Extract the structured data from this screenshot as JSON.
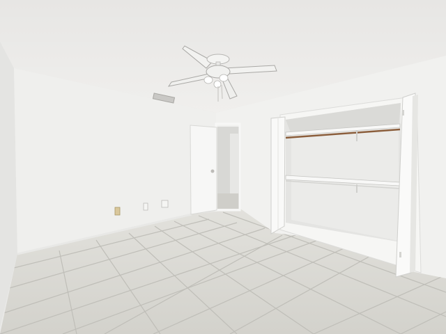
{
  "scene": {
    "colors": {
      "ceiling": "#ecebea",
      "wall_back": "#efefed",
      "wall_left": "#e4e4e2",
      "wall_right": "#f1f1ef",
      "floor": "#dcdbd6",
      "grout": "#bdbcb7",
      "door": "#f6f6f5",
      "closet_interior": "#e6e6e4",
      "fan_body": "#f3f3f1",
      "wood_rod": "#8b5e3c"
    },
    "objects": {
      "ceiling_fan": "ceiling-fan",
      "air_vent": "air-vent",
      "bedroom_door": "open-door",
      "hallway": "hallway-opening",
      "closet": "closet-with-bifold-doors",
      "outlet_left": "wall-outlet",
      "outlet_mid": "wall-outlet",
      "switch_plate": "light-switch"
    }
  }
}
